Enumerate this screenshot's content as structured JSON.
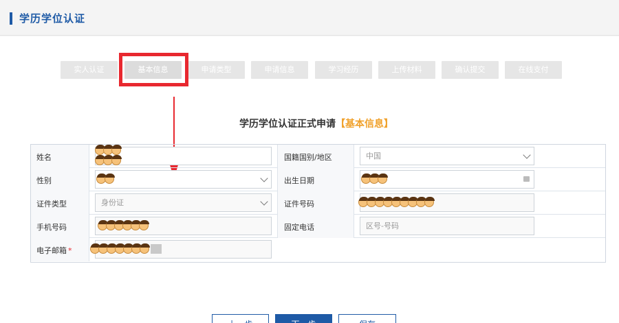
{
  "header": {
    "title": "学历学位认证"
  },
  "steps": [
    {
      "label": "实人认证"
    },
    {
      "label": "基本信息"
    },
    {
      "label": "申请类型"
    },
    {
      "label": "申请信息"
    },
    {
      "label": "学习经历"
    },
    {
      "label": "上传材料"
    },
    {
      "label": "确认提交"
    },
    {
      "label": "在线支付"
    }
  ],
  "active_step": "基本信息",
  "form": {
    "title": "学历学位认证正式申请",
    "title_accent": "【基本信息】",
    "fields": {
      "name": {
        "label": "姓名"
      },
      "nationality": {
        "label": "国籍国别/地区",
        "value": "中国"
      },
      "gender": {
        "label": "性别"
      },
      "birth_date": {
        "label": "出生日期"
      },
      "id_type": {
        "label": "证件类型",
        "value": "身份证"
      },
      "id_number": {
        "label": "证件号码"
      },
      "mobile": {
        "label": "手机号码"
      },
      "landline": {
        "label": "固定电话",
        "placeholder": "区号-号码"
      },
      "email": {
        "label": "电子邮箱",
        "required_mark": "*"
      }
    }
  },
  "buttons": {
    "prev": "上一步",
    "next": "下一步",
    "save": "保存"
  },
  "colors": {
    "brand": "#1e5aa6",
    "accent": "#f0a12b",
    "highlight": "#e8282f"
  }
}
